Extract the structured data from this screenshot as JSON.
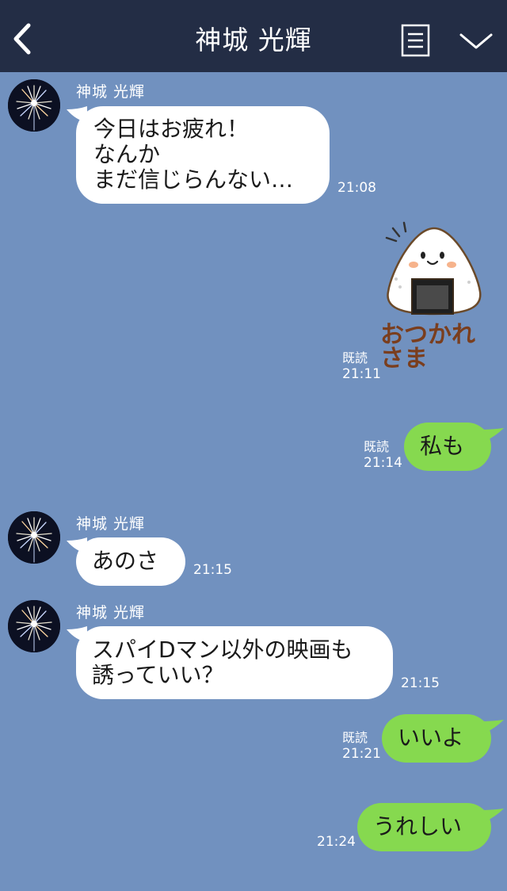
{
  "header": {
    "contact_name": "神城 光輝"
  },
  "icons": {
    "back": "chevron-left-icon",
    "menu": "menu-list-icon",
    "collapse": "chevron-down-icon",
    "avatar": "fireworks-avatar"
  },
  "messages": [
    {
      "side": "left",
      "sender": "神城 光輝",
      "text": "今日はお疲れ！\nなんか\nまだ信じらんない…",
      "time": "21:08"
    },
    {
      "side": "right",
      "type": "sticker",
      "sticker_text": "おつかれさま",
      "read": "既読",
      "time": "21:11"
    },
    {
      "side": "right",
      "text": "私も",
      "read": "既読",
      "time": "21:14"
    },
    {
      "side": "left",
      "sender": "神城 光輝",
      "text": "あのさ",
      "time": "21:15"
    },
    {
      "side": "left",
      "sender": "神城 光輝",
      "text": "スパイDマン以外の映画も\n誘っていい？",
      "time": "21:15"
    },
    {
      "side": "right",
      "text": "いいよ",
      "read": "既読",
      "time": "21:21"
    },
    {
      "side": "right",
      "text": "うれしい",
      "time": "21:24"
    }
  ],
  "colors": {
    "header_bg": "#232d45",
    "chat_bg": "#7191bf",
    "sent_bubble": "#86d94f",
    "received_bubble": "#ffffff"
  }
}
